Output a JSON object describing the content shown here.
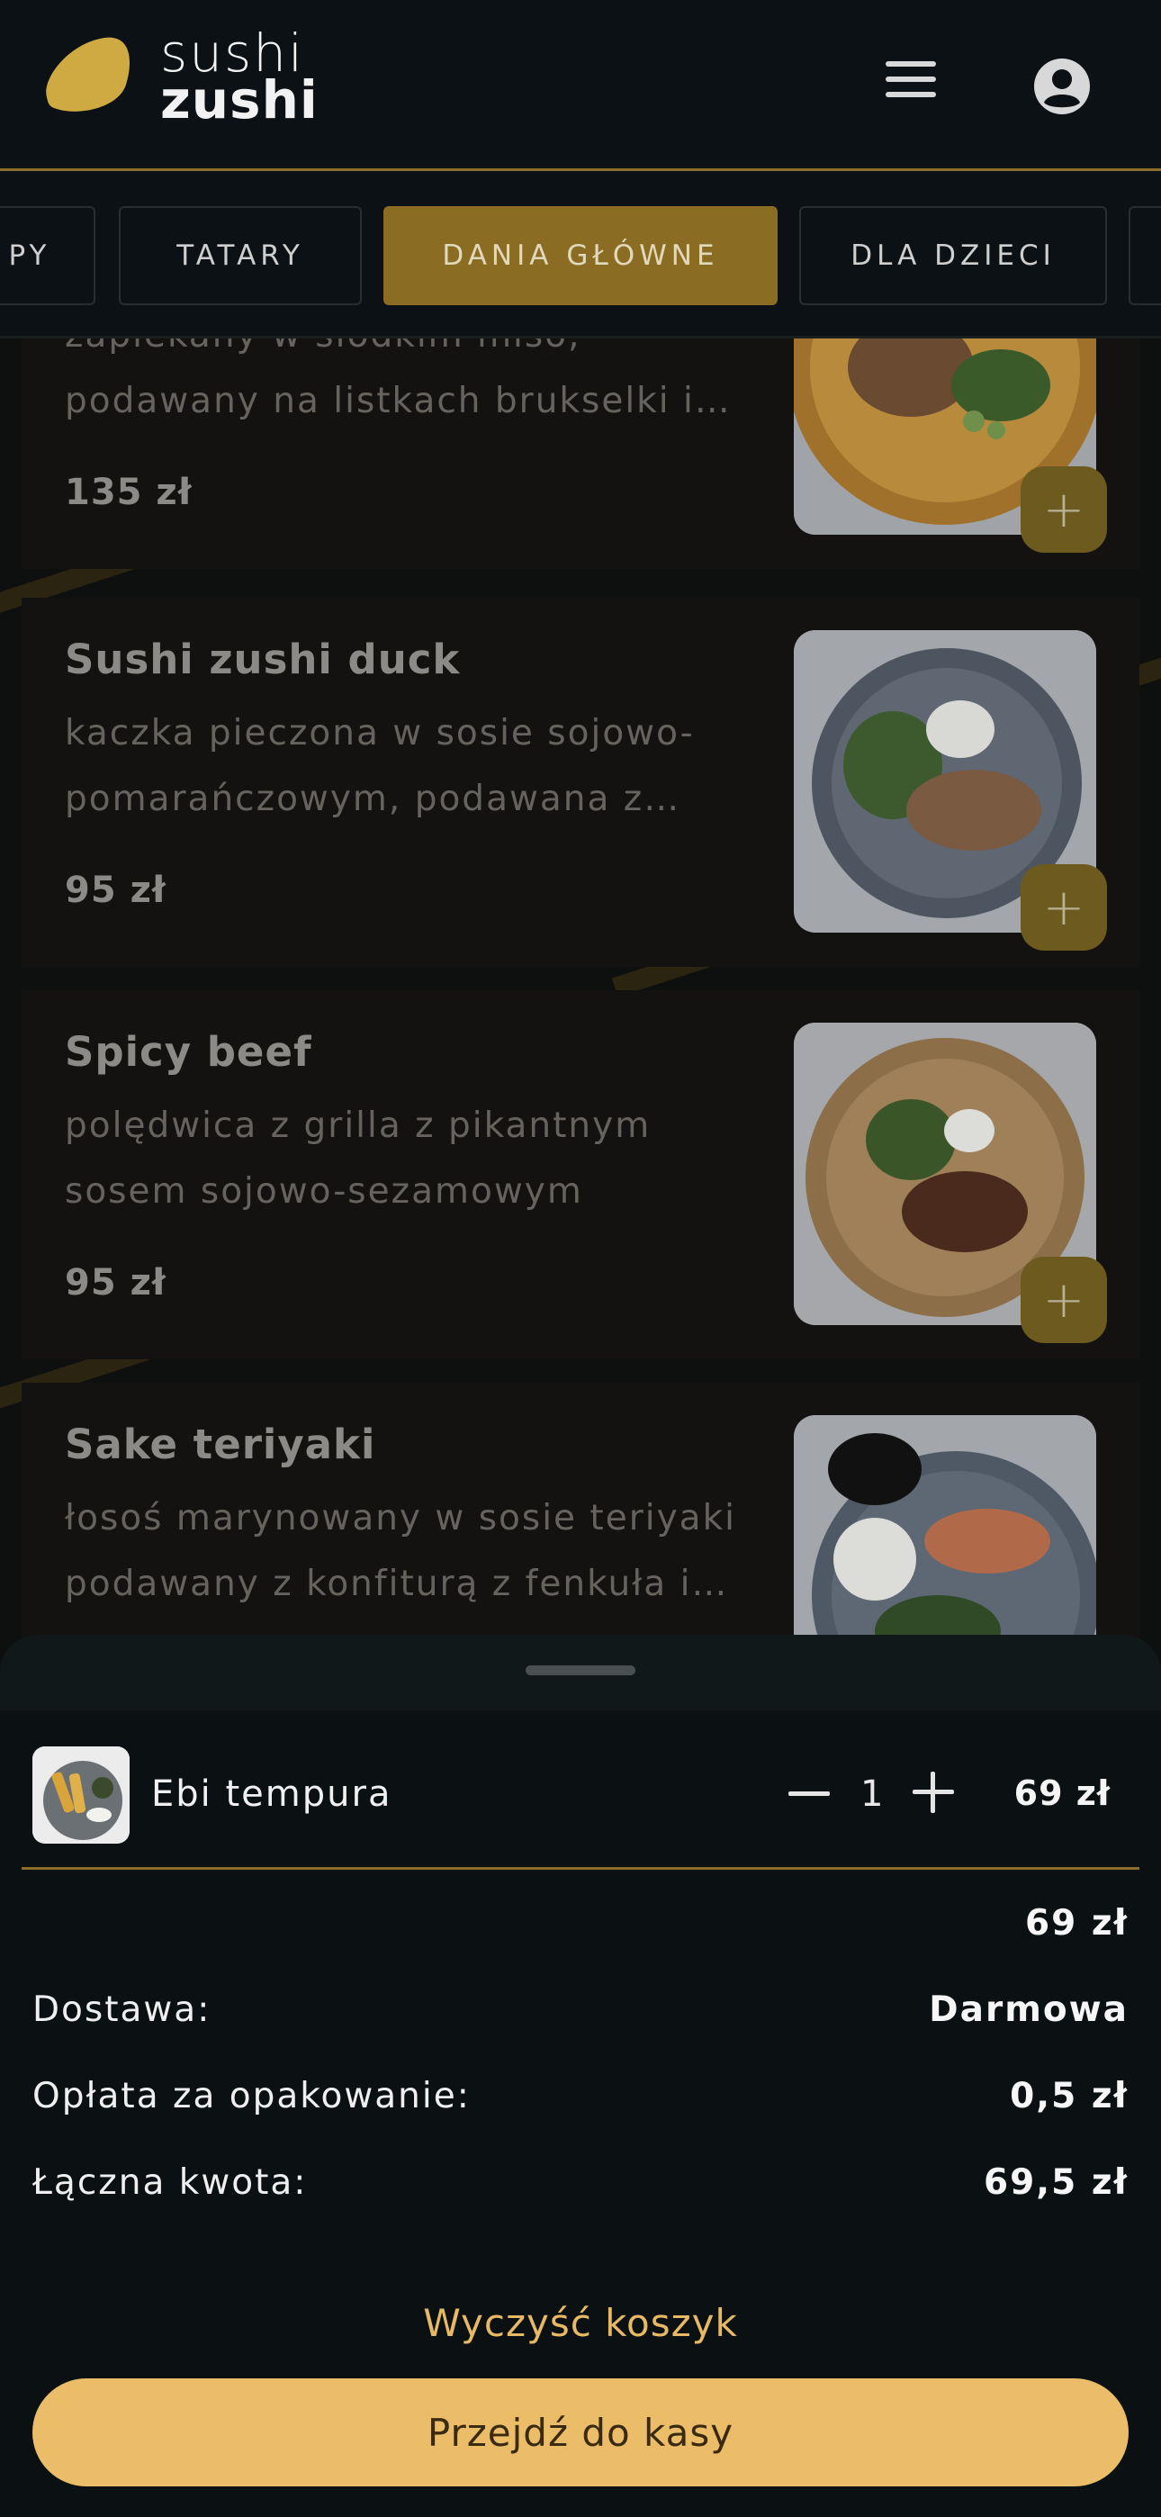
{
  "header": {
    "logo_line1": "sushi",
    "logo_line2": "zushi",
    "menu_icon": "hamburger-menu-icon",
    "account_icon": "account-circle-icon"
  },
  "tabs": [
    {
      "label": "PY",
      "active": false
    },
    {
      "label": "TATARY",
      "active": false
    },
    {
      "label": "DANIA GŁÓWNE",
      "active": true
    },
    {
      "label": "DLA DZIECI",
      "active": false
    }
  ],
  "menu_items": [
    {
      "title": "",
      "desc_line1": "zapiekany w słodkim miso,",
      "desc_line2": "podawany na listkach brukselki i…",
      "price": "135 zł"
    },
    {
      "title": "Sushi zushi duck",
      "desc_line1": "kaczka pieczona w sosie sojowo-",
      "desc_line2": "pomarańczowym, podawana z…",
      "price": "95 zł"
    },
    {
      "title": "Spicy beef",
      "desc_line1": "polędwica z grilla z pikantnym",
      "desc_line2": "sosem sojowo-sezamowym",
      "price": "95 zł"
    },
    {
      "title": "Sake teriyaki",
      "desc_line1": "łosoś marynowany w sosie teriyaki",
      "desc_line2": "podawany z konfiturą z fenkuła i…",
      "price": ""
    }
  ],
  "cart": {
    "item": {
      "name": "Ebi tempura",
      "quantity": "1",
      "price": "69 zł"
    },
    "subtotal": "69 zł",
    "delivery_label": "Dostawa:",
    "delivery_value": "Darmowa",
    "packaging_label": "Opłata za opakowanie:",
    "packaging_value": "0,5 zł",
    "total_label": "Łączna kwota:",
    "total_value": "69,5 zł",
    "clear_label": "Wyczyść koszyk",
    "checkout_label": "Przejdź do kasy"
  },
  "colors": {
    "accent_gold": "#ecbd68",
    "header_bg": "#0b1114",
    "active_tab": "#8a6d22"
  }
}
